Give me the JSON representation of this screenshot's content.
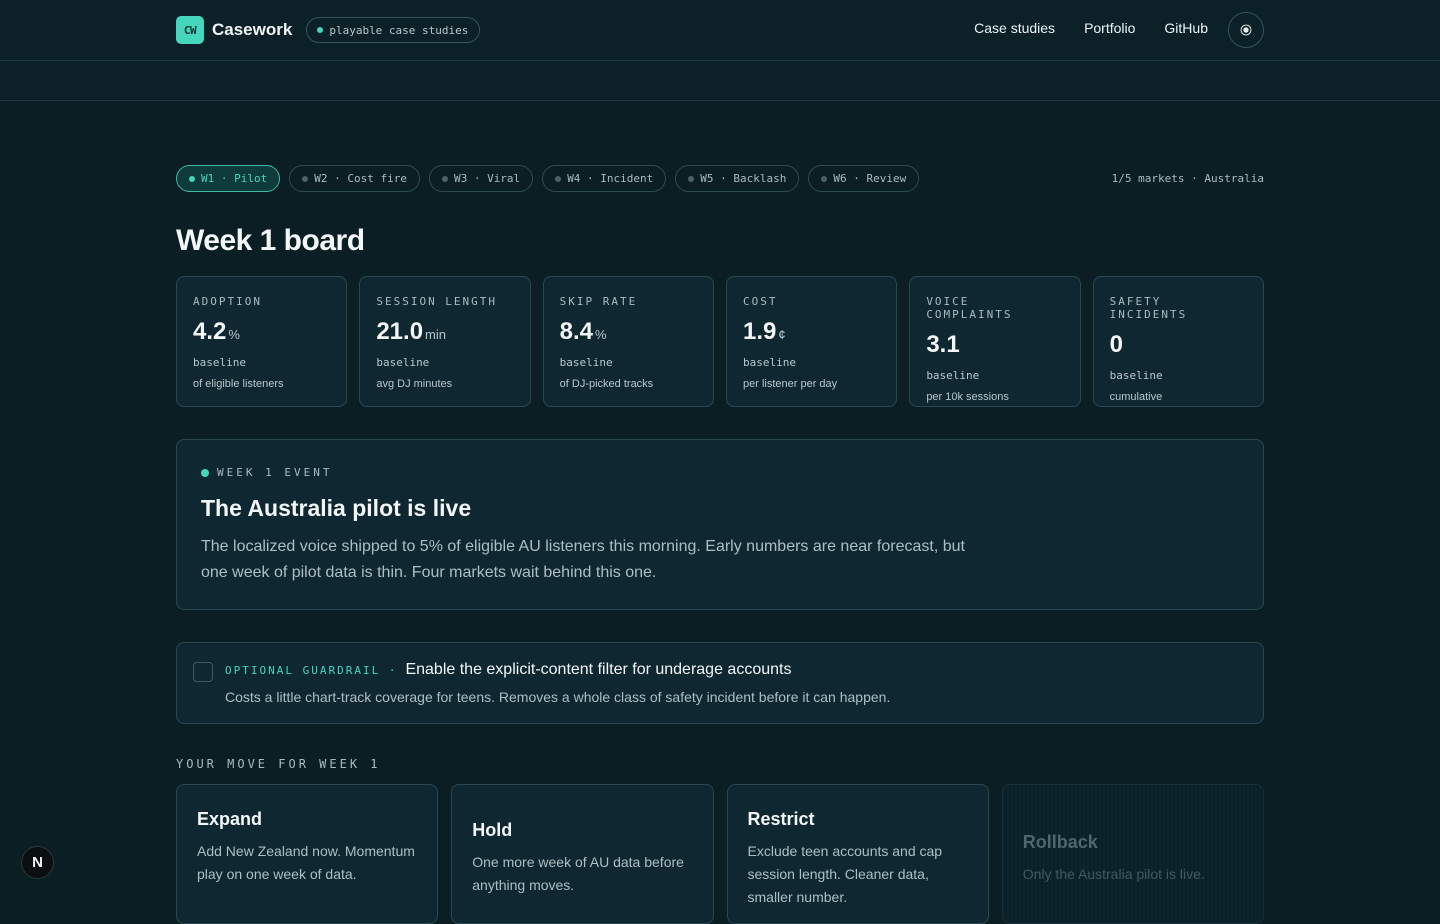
{
  "header": {
    "logo": "CW",
    "brand": "Casework",
    "pill": "playable case studies",
    "nav": [
      "Case studies",
      "Portfolio",
      "GitHub"
    ]
  },
  "weeks": {
    "tabs": [
      "W1 · Pilot",
      "W2 · Cost fire",
      "W3 · Viral",
      "W4 · Incident",
      "W5 · Backlash",
      "W6 · Review"
    ],
    "active": 0,
    "markets": "1/5 markets · Australia"
  },
  "board_title": "Week 1 board",
  "metrics": [
    {
      "label": "ADOPTION",
      "value": "4.2",
      "unit": "%",
      "base": "baseline",
      "desc": "of eligible listeners"
    },
    {
      "label": "SESSION LENGTH",
      "value": "21.0",
      "unit": "min",
      "base": "baseline",
      "desc": "avg DJ minutes"
    },
    {
      "label": "SKIP RATE",
      "value": "8.4",
      "unit": "%",
      "base": "baseline",
      "desc": "of DJ-picked tracks"
    },
    {
      "label": "COST",
      "value": "1.9",
      "unit": "¢",
      "base": "baseline",
      "desc": "per listener per day"
    },
    {
      "label": "VOICE COMPLAINTS",
      "value": "3.1",
      "unit": "",
      "base": "baseline",
      "desc": "per 10k sessions"
    },
    {
      "label": "SAFETY INCIDENTS",
      "value": "0",
      "unit": "",
      "base": "baseline",
      "desc": "cumulative"
    }
  ],
  "event": {
    "kicker": "WEEK 1 EVENT",
    "title": "The Australia pilot is live",
    "body": "The localized voice shipped to 5% of eligible AU listeners this morning. Early numbers are near forecast, but one week of pilot data is thin. Four markets wait behind this one."
  },
  "guardrail": {
    "tag": "OPTIONAL GUARDRAIL ·",
    "title": "Enable the explicit-content filter for underage accounts",
    "sub": "Costs a little chart-track coverage for teens. Removes a whole class of safety incident before it can happen.",
    "checked": false
  },
  "moves_title": "YOUR MOVE FOR WEEK 1",
  "moves": [
    {
      "title": "Expand",
      "desc": "Add New Zealand now. Momentum play on one week of data."
    },
    {
      "title": "Hold",
      "desc": "One more week of AU data before anything moves."
    },
    {
      "title": "Restrict",
      "desc": "Exclude teen accounts and cap session length. Cleaner data, smaller number."
    },
    {
      "title": "Rollback",
      "desc": "Only the Australia pilot is live."
    }
  ],
  "badge": "N"
}
